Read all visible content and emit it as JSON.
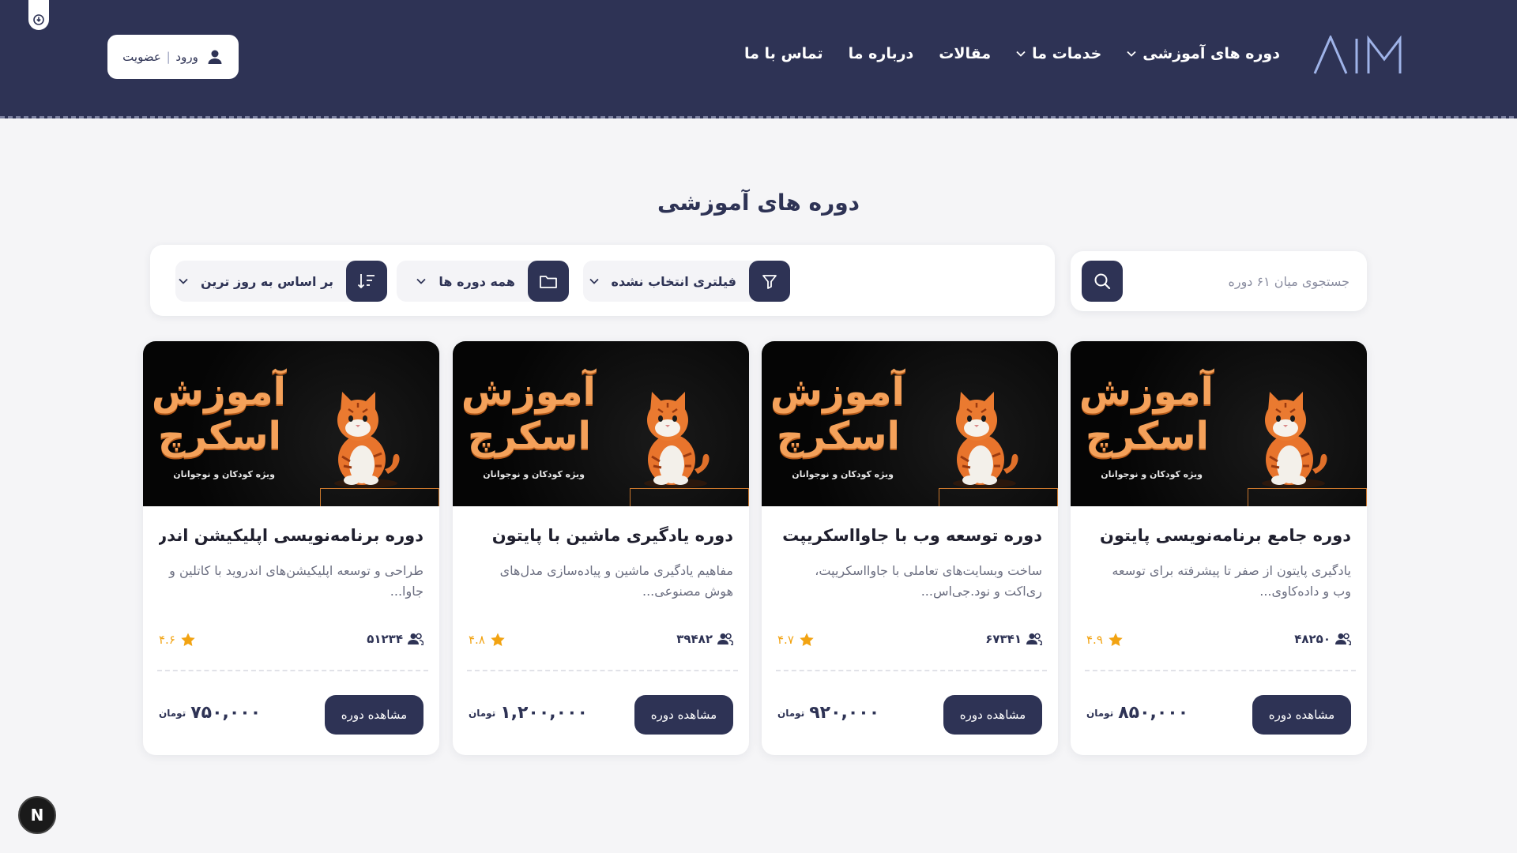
{
  "header": {
    "logo_text": "AIM",
    "nav": [
      {
        "label": "دوره های آموزشی",
        "has_dropdown": true
      },
      {
        "label": "خدمات ما",
        "has_dropdown": true
      },
      {
        "label": "مقالات",
        "has_dropdown": false
      },
      {
        "label": "درباره ما",
        "has_dropdown": false
      },
      {
        "label": "تماس با ما",
        "has_dropdown": false
      }
    ],
    "login": {
      "login_label": "ورود",
      "separator": "|",
      "register_label": "عضویت"
    }
  },
  "page_title": "دوره های آموزشی",
  "search": {
    "placeholder": "جستجوی میان ۶۱ دوره"
  },
  "filters": {
    "filter_label": "فیلتری انتخاب نشده",
    "category_label": "همه دوره ها",
    "sort_label": "بر اساس به روز ترین"
  },
  "thumbnail": {
    "line1": "آموزش",
    "line2": "اسکرچ",
    "line3": "ویژه کودکان و نوجوانان"
  },
  "courses": [
    {
      "title": "دوره جامع برنامه‌نویسی پایتون",
      "description": "یادگیری پایتون از صفر تا پیشرفته برای توسعه وب و داده‌کاوی...",
      "students": "۴۸۲۵۰",
      "rating": "۴.۹",
      "view_label": "مشاهده دوره",
      "price": "۸۵۰,۰۰۰",
      "currency": "تومان"
    },
    {
      "title": "دوره توسعه وب با جاوااسکریپت",
      "description": "ساخت وبسایت‌های تعاملی با جاوااسکریپت، ری‌اکت و نود.جی‌اس...",
      "students": "۶۷۳۴۱",
      "rating": "۴.۷",
      "view_label": "مشاهده دوره",
      "price": "۹۲۰,۰۰۰",
      "currency": "تومان"
    },
    {
      "title": "دوره یادگیری ماشین با پایتون",
      "description": "مفاهیم یادگیری ماشین و پیاده‌سازی مدل‌های هوش مصنوعی...",
      "students": "۳۹۴۸۲",
      "rating": "۴.۸",
      "view_label": "مشاهده دوره",
      "price": "۱,۲۰۰,۰۰۰",
      "currency": "تومان"
    },
    {
      "title": "دوره برنامه‌نویسی اپلیکیشن اندروید",
      "description": "طراحی و توسعه اپلیکیشن‌های اندروید با کاتلین و جاوا...",
      "students": "۵۱۲۳۴",
      "rating": "۴.۶",
      "view_label": "مشاهده دوره",
      "price": "۷۵۰,۰۰۰",
      "currency": "تومان"
    }
  ],
  "fab": {
    "label": "N"
  },
  "colors": {
    "primary": "#2e3355",
    "star": "#f2a312",
    "background": "#f5f5f7",
    "thumb_text": "#f4a15a"
  }
}
